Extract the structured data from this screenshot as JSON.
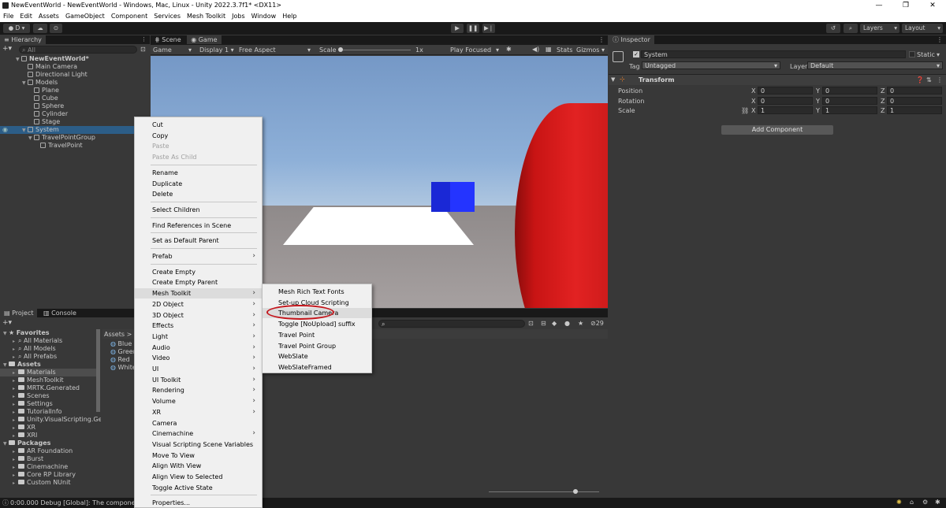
{
  "window": {
    "title": "NewEventWorld - NewEventWorld - Windows, Mac, Linux - Unity 2022.3.7f1* <DX11>",
    "controls": [
      "—",
      "❐",
      "✕"
    ]
  },
  "menu": [
    "File",
    "Edit",
    "Assets",
    "GameObject",
    "Component",
    "Services",
    "Mesh Toolkit",
    "Jobs",
    "Window",
    "Help"
  ],
  "toolbar": {
    "account": "D ▾",
    "layers": "Layers",
    "layout": "Layout"
  },
  "hierarchy": {
    "tab": "Hierarchy",
    "search_placeholder": "All",
    "rows": [
      {
        "label": "NewEventWorld*",
        "indent": 0,
        "arrow": "▼"
      },
      {
        "label": "Main Camera",
        "indent": 1,
        "arrow": ""
      },
      {
        "label": "Directional Light",
        "indent": 1,
        "arrow": ""
      },
      {
        "label": "Models",
        "indent": 1,
        "arrow": "▼"
      },
      {
        "label": "Plane",
        "indent": 2,
        "arrow": ""
      },
      {
        "label": "Cube",
        "indent": 2,
        "arrow": ""
      },
      {
        "label": "Sphere",
        "indent": 2,
        "arrow": ""
      },
      {
        "label": "Cylinder",
        "indent": 2,
        "arrow": ""
      },
      {
        "label": "Stage",
        "indent": 2,
        "arrow": ""
      },
      {
        "label": "System",
        "indent": 1,
        "arrow": "▼",
        "selected": true
      },
      {
        "label": "TravelPointGroup",
        "indent": 2,
        "arrow": "▼"
      },
      {
        "label": "TravelPoint",
        "indent": 3,
        "arrow": ""
      }
    ]
  },
  "scene_tabs": [
    "Scene",
    "Game"
  ],
  "game_bar": {
    "mode": "Game",
    "display": "Display 1",
    "aspect": "Free Aspect",
    "scale_label": "Scale",
    "scale_value": "1x",
    "play_focused": "Play Focused",
    "stats": "Stats",
    "gizmos": "Gizmos"
  },
  "context_menu": {
    "items": [
      {
        "label": "Cut",
        "disabled": false,
        "sub": false
      },
      {
        "label": "Copy",
        "disabled": false,
        "sub": false
      },
      {
        "label": "Paste",
        "disabled": true,
        "sub": false
      },
      {
        "label": "Paste As Child",
        "disabled": true,
        "sub": false
      },
      {
        "sep": true
      },
      {
        "label": "Rename",
        "disabled": false,
        "sub": false
      },
      {
        "label": "Duplicate",
        "disabled": false,
        "sub": false
      },
      {
        "label": "Delete",
        "disabled": false,
        "sub": false
      },
      {
        "sep": true
      },
      {
        "label": "Select Children",
        "disabled": false,
        "sub": false
      },
      {
        "sep": true
      },
      {
        "label": "Find References in Scene",
        "disabled": false,
        "sub": false
      },
      {
        "sep": true
      },
      {
        "label": "Set as Default Parent",
        "disabled": false,
        "sub": false
      },
      {
        "sep": true
      },
      {
        "label": "Prefab",
        "disabled": false,
        "sub": true
      },
      {
        "sep": true
      },
      {
        "label": "Create Empty",
        "disabled": false,
        "sub": false
      },
      {
        "label": "Create Empty Parent",
        "disabled": false,
        "sub": false
      },
      {
        "label": "Mesh Toolkit",
        "disabled": false,
        "sub": true,
        "highlight": true
      },
      {
        "label": "2D Object",
        "disabled": false,
        "sub": true
      },
      {
        "label": "3D Object",
        "disabled": false,
        "sub": true
      },
      {
        "label": "Effects",
        "disabled": false,
        "sub": true
      },
      {
        "label": "Light",
        "disabled": false,
        "sub": true
      },
      {
        "label": "Audio",
        "disabled": false,
        "sub": true
      },
      {
        "label": "Video",
        "disabled": false,
        "sub": true
      },
      {
        "label": "UI",
        "disabled": false,
        "sub": true
      },
      {
        "label": "UI Toolkit",
        "disabled": false,
        "sub": true
      },
      {
        "label": "Rendering",
        "disabled": false,
        "sub": true
      },
      {
        "label": "Volume",
        "disabled": false,
        "sub": true
      },
      {
        "label": "XR",
        "disabled": false,
        "sub": true
      },
      {
        "label": "Camera",
        "disabled": false,
        "sub": false
      },
      {
        "label": "Cinemachine",
        "disabled": false,
        "sub": true
      },
      {
        "label": "Visual Scripting Scene Variables",
        "disabled": false,
        "sub": false
      },
      {
        "label": "Move To View",
        "disabled": false,
        "sub": false
      },
      {
        "label": "Align With View",
        "disabled": false,
        "sub": false
      },
      {
        "label": "Align View to Selected",
        "disabled": false,
        "sub": false
      },
      {
        "label": "Toggle Active State",
        "disabled": false,
        "sub": false
      },
      {
        "sep": true
      },
      {
        "label": "Properties...",
        "disabled": false,
        "sub": false
      }
    ]
  },
  "submenu": {
    "items": [
      {
        "label": "Mesh Rich Text Fonts"
      },
      {
        "label": "Set-up Cloud Scripting"
      },
      {
        "label": "Thumbnail Camera",
        "highlight": true
      },
      {
        "label": "Toggle [NoUpload] suffix"
      },
      {
        "label": "Travel Point"
      },
      {
        "label": "Travel Point Group"
      },
      {
        "label": "WebSlate"
      },
      {
        "label": "WebSlateFramed"
      }
    ]
  },
  "project": {
    "tabs": [
      "Project",
      "Console"
    ],
    "favorites_label": "Favorites",
    "favorites": [
      "All Materials",
      "All Models",
      "All Prefabs"
    ],
    "assets_label": "Assets",
    "assets": [
      "Materials",
      "MeshToolkit",
      "MRTK.Generated",
      "Scenes",
      "Settings",
      "TutorialInfo",
      "Unity.VisualScripting.Gene",
      "XR",
      "XRI"
    ],
    "packages_label": "Packages",
    "packages": [
      "AR Foundation",
      "Burst",
      "Cinemachine",
      "Core RP Library",
      "Custom NUnit"
    ],
    "breadcrumb": "Assets > M",
    "materials": [
      "Blue",
      "Green",
      "Red",
      "White"
    ],
    "hidden_count": "29"
  },
  "inspector": {
    "tab": "Inspector",
    "object_name": "System",
    "static_label": "Static",
    "tag_label": "Tag",
    "tag_value": "Untagged",
    "layer_label": "Layer",
    "layer_value": "Default",
    "component": "Transform",
    "rows": [
      {
        "label": "Position",
        "x": "0",
        "y": "0",
        "z": "0"
      },
      {
        "label": "Rotation",
        "x": "0",
        "y": "0",
        "z": "0"
      },
      {
        "label": "Scale",
        "x": "1",
        "y": "1",
        "z": "1"
      }
    ],
    "add_component": "Add Component"
  },
  "status": {
    "message": "0:00.000 Debug [Global]: The component Tr"
  },
  "colors": {
    "highlight_ring": "#c4161c",
    "selection": "#2c5d87",
    "game_sky": "#7ea3cf",
    "game_ground": "#a19a9a",
    "red_cylinder": "#d81c1c",
    "blue_cube": "#1e2ee0"
  }
}
